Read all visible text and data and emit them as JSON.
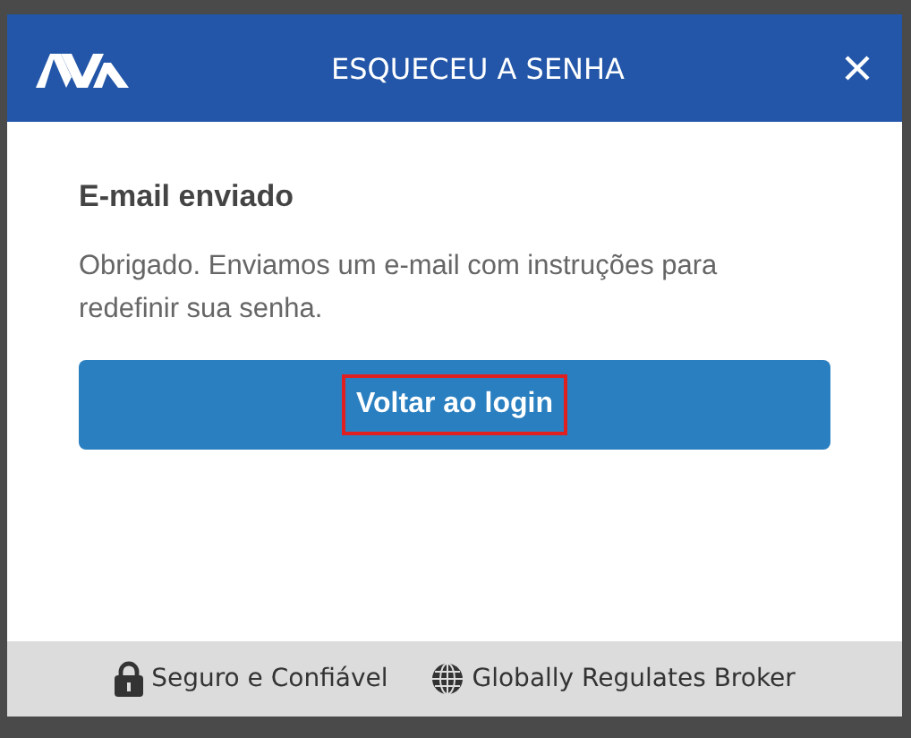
{
  "dialog": {
    "title": "ESQUECEU A SENHA",
    "heading": "E-mail enviado",
    "message": "Obrigado. Enviamos um e-mail com instruções para redefinir sua senha.",
    "button": {
      "label": "Voltar ao login",
      "highlighted": true
    }
  },
  "footer": {
    "badges": [
      {
        "kind": "lock",
        "label": "Seguro e Confiável"
      },
      {
        "kind": "globe",
        "label": "Globally Regulates Broker"
      }
    ]
  }
}
